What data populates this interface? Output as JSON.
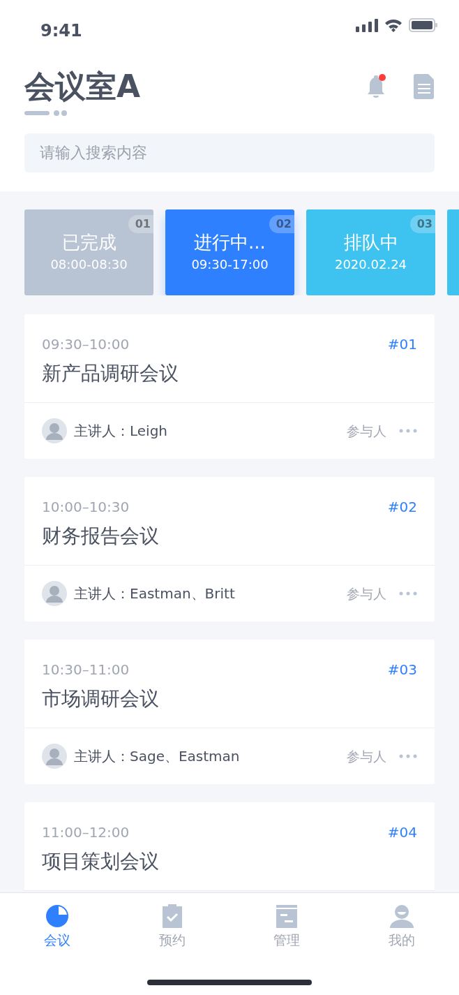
{
  "status_bar": {
    "time": "9:41"
  },
  "header": {
    "title": "会议室A",
    "notification": {
      "unread": true
    }
  },
  "search": {
    "placeholder": "请输入搜索内容"
  },
  "status_cards": [
    {
      "label": "已完成",
      "sub": "08:00-08:30",
      "number": "01",
      "color": "#b8c3d3",
      "selected": false
    },
    {
      "label": "进行中...",
      "sub": "09:30-17:00",
      "number": "02",
      "color": "#2f80fe",
      "selected": true
    },
    {
      "label": "排队中",
      "sub": "2020.02.24",
      "number": "03",
      "color": "#3ec2f0",
      "selected": false
    },
    {
      "color": "#3ec2f0",
      "selected": false
    }
  ],
  "meetings": [
    {
      "time": "09:30–10:00",
      "number": "#01",
      "title": "新产品调研会议",
      "speaker": "主讲人：Leigh",
      "participants": "参与人"
    },
    {
      "time": "10:00–10:30",
      "number": "#02",
      "title": "财务报告会议",
      "speaker": "主讲人：Eastman、Britt",
      "participants": "参与人"
    },
    {
      "time": "10:30–11:00",
      "number": "#03",
      "title": "市场调研会议",
      "speaker": "主讲人：Sage、Eastman",
      "participants": "参与人"
    },
    {
      "time": "11:00–12:00",
      "number": "#04",
      "title": "项目策划会议"
    }
  ],
  "tab_bar": [
    {
      "label": "会议",
      "kind": "pie",
      "selected": true
    },
    {
      "label": "预约",
      "kind": "clipboard",
      "selected": false
    },
    {
      "label": "管理",
      "kind": "panel",
      "selected": false
    },
    {
      "label": "我的",
      "kind": "person",
      "selected": false
    }
  ]
}
